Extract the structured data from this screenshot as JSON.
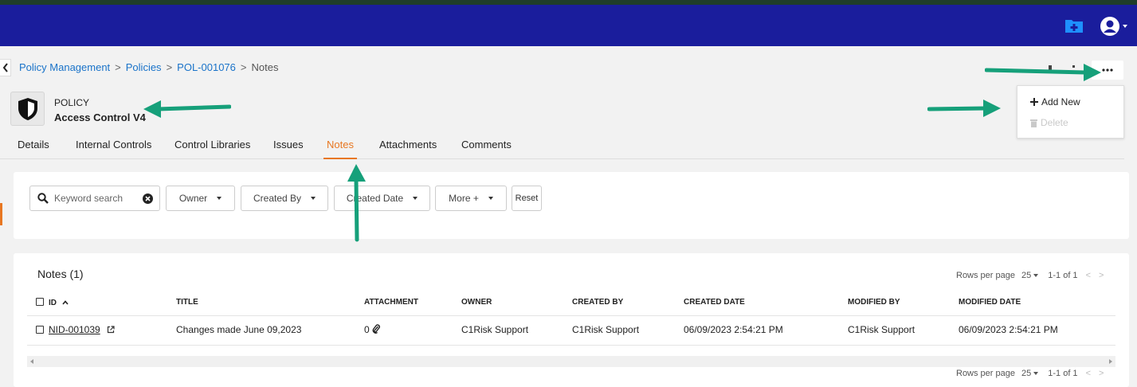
{
  "colors": {
    "topbar": "#1a1d9c",
    "accent": "#e87722",
    "link": "#1a73c9",
    "annotation_arrow": "#16a07a"
  },
  "topbar": {
    "icons": [
      "folder-plus-icon",
      "user-avatar-icon"
    ]
  },
  "breadcrumb": {
    "items": [
      "Policy Management",
      "Policies",
      "POL-001076"
    ],
    "current": "Notes"
  },
  "entity": {
    "type": "POLICY",
    "name": "Access Control V4",
    "icon": "shield-icon"
  },
  "tabs": [
    {
      "label": "Details"
    },
    {
      "label": "Internal Controls"
    },
    {
      "label": "Control Libraries"
    },
    {
      "label": "Issues"
    },
    {
      "label": "Notes",
      "active": true
    },
    {
      "label": "Attachments"
    },
    {
      "label": "Comments"
    }
  ],
  "actions_menu": {
    "add_new": "Add New",
    "delete": "Delete"
  },
  "filters": {
    "search_placeholder": "Keyword search",
    "owner": "Owner",
    "created_by": "Created By",
    "created_date": "Created Date",
    "more": "More +",
    "reset": "Reset"
  },
  "notes_table": {
    "title": "Notes (1)",
    "rows_per_page_label": "Rows per page",
    "rows_per_page": "25",
    "range": "1-1 of 1",
    "columns": [
      "ID",
      "TITLE",
      "ATTACHMENT",
      "OWNER",
      "CREATED BY",
      "CREATED DATE",
      "MODIFIED BY",
      "MODIFIED DATE"
    ],
    "rows": [
      {
        "id": "NID-001039",
        "title": "Changes made June 09,2023",
        "attachment": "0",
        "owner": "C1Risk Support",
        "created_by": "C1Risk Support",
        "created_date": "06/09/2023 2:54:21 PM",
        "modified_by": "C1Risk Support",
        "modified_date": "06/09/2023 2:54:21 PM"
      }
    ]
  }
}
